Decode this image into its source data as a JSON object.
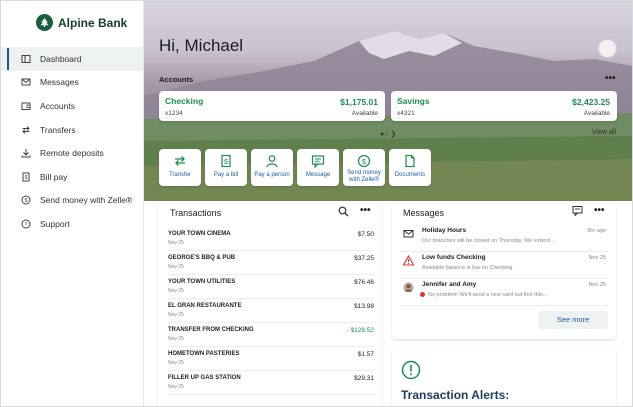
{
  "brand": {
    "name": "Alpine Bank"
  },
  "sidebar": {
    "items": [
      {
        "label": "Dashboard",
        "icon": "dashboard-icon"
      },
      {
        "label": "Messages",
        "icon": "envelope-icon"
      },
      {
        "label": "Accounts",
        "icon": "wallet-icon"
      },
      {
        "label": "Transfers",
        "icon": "transfer-arrows-icon"
      },
      {
        "label": "Remote deposits",
        "icon": "download-icon"
      },
      {
        "label": "Bill pay",
        "icon": "receipt-icon"
      },
      {
        "label": "Send money with Zelle®",
        "icon": "dollar-circle-icon"
      },
      {
        "label": "Support",
        "icon": "help-circle-icon"
      }
    ]
  },
  "greeting": "Hi, Michael",
  "accounts": {
    "title": "Accounts",
    "more": "•••",
    "view_all": "View all",
    "pager": "●○ ❯",
    "cards": [
      {
        "name": "Checking",
        "number": "x1234",
        "amount": "$1,175.01",
        "sub": "Available"
      },
      {
        "name": "Savings",
        "number": "x4321",
        "amount": "$2,423.25",
        "sub": "Available"
      }
    ]
  },
  "quick_actions": [
    {
      "label": "Transfer",
      "icon": "transfer-arrows-icon"
    },
    {
      "label": "Pay a bill",
      "icon": "dollar-receipt-icon"
    },
    {
      "label": "Pay a person",
      "icon": "person-icon"
    },
    {
      "label": "Message",
      "icon": "chat-icon"
    },
    {
      "label": "Send money with Zelle®",
      "icon": "dollar-circle-icon"
    },
    {
      "label": "Documents",
      "icon": "document-icon"
    }
  ],
  "transactions": {
    "title": "Transactions",
    "more": "•••",
    "rows": [
      {
        "merchant": "YOUR TOWN CINEMA",
        "date": "Nov 25",
        "amount": "$7.50"
      },
      {
        "merchant": "GEORGE'S BBQ & PUB",
        "date": "Nov 25",
        "amount": "$37.25"
      },
      {
        "merchant": "YOUR TOWN UTILITIES",
        "date": "Nov 25",
        "amount": "$76.46"
      },
      {
        "merchant": "EL GRAN RESTAURANTE",
        "date": "Nov 25",
        "amount": "$13.98"
      },
      {
        "merchant": "TRANSFER FROM CHECKING",
        "date": "Nov 25",
        "amount": "- $128.52"
      },
      {
        "merchant": "HOMETOWN PASTERIES",
        "date": "Nov 25",
        "amount": "$1.57"
      },
      {
        "merchant": "FILLER UP GAS STATION",
        "date": "Nov 25",
        "amount": "$29.31"
      }
    ]
  },
  "messages": {
    "title": "Messages",
    "more": "•••",
    "see_more": "See more",
    "rows": [
      {
        "title": "Holiday Hours",
        "preview": "Our branches will be closed on Thursday. We extend...",
        "date": "8hr ago",
        "icon": "envelope-icon"
      },
      {
        "title": "Low funds Checking",
        "preview": "Available balance is low on Checking",
        "date": "Nov 25",
        "icon": "warning-icon"
      },
      {
        "title": "Jennifer and Amy",
        "preview": "No problem! We'll send a new card out first thin...",
        "date": "Nov 25",
        "icon": "avatar-icon"
      }
    ]
  },
  "alerts": {
    "title": "Transaction Alerts:"
  },
  "colors": {
    "accent_green": "#1e8c4e",
    "brand_green": "#1b5e3d",
    "link_blue": "#1e5aa0",
    "nav_active_bar": "#1d5a8c"
  }
}
